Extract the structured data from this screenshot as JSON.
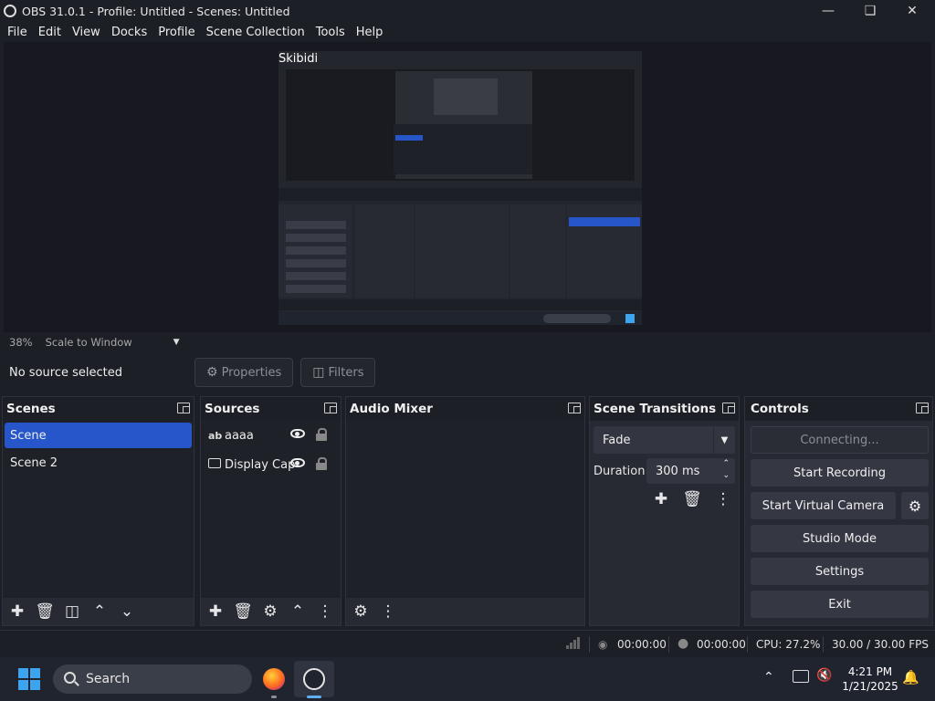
{
  "window": {
    "title": "OBS 31.0.1 - Profile: Untitled - Scenes: Untitled"
  },
  "menu": [
    "File",
    "Edit",
    "View",
    "Docks",
    "Profile",
    "Scene Collection",
    "Tools",
    "Help"
  ],
  "preview": {
    "source_label": "Skibidi",
    "zoom": "38%",
    "scale_mode": "Scale to Window"
  },
  "source_toolbar": {
    "status": "No source selected",
    "properties_label": "Properties",
    "filters_label": "Filters"
  },
  "scenes": {
    "title": "Scenes",
    "items": [
      {
        "label": "Scene",
        "selected": true
      },
      {
        "label": "Scene 2",
        "selected": false
      }
    ]
  },
  "sources": {
    "title": "Sources",
    "items": [
      {
        "label": "aaaa",
        "icon": "text-icon",
        "icon_glyph": "ab"
      },
      {
        "label": "Display Cap",
        "icon": "monitor-icon",
        "icon_glyph": ""
      }
    ]
  },
  "audio_mixer": {
    "title": "Audio Mixer"
  },
  "transitions": {
    "title": "Scene Transitions",
    "selected": "Fade",
    "duration_label": "Duration",
    "duration_value": "300 ms"
  },
  "controls": {
    "title": "Controls",
    "connecting": "Connecting...",
    "start_recording": "Start Recording",
    "start_virtual_camera": "Start Virtual Camera",
    "studio_mode": "Studio Mode",
    "settings": "Settings",
    "exit": "Exit"
  },
  "statusbar": {
    "stream_time": "00:00:00",
    "rec_time": "00:00:00",
    "cpu": "CPU: 27.2%",
    "fps": "30.00 / 30.00 FPS"
  },
  "taskbar": {
    "search_label": "Search",
    "time": "4:21 PM",
    "date": "1/21/2025"
  },
  "colors": {
    "accent": "#2656c9",
    "dock_bg": "#272a33",
    "window_bg": "#1d1f26"
  }
}
